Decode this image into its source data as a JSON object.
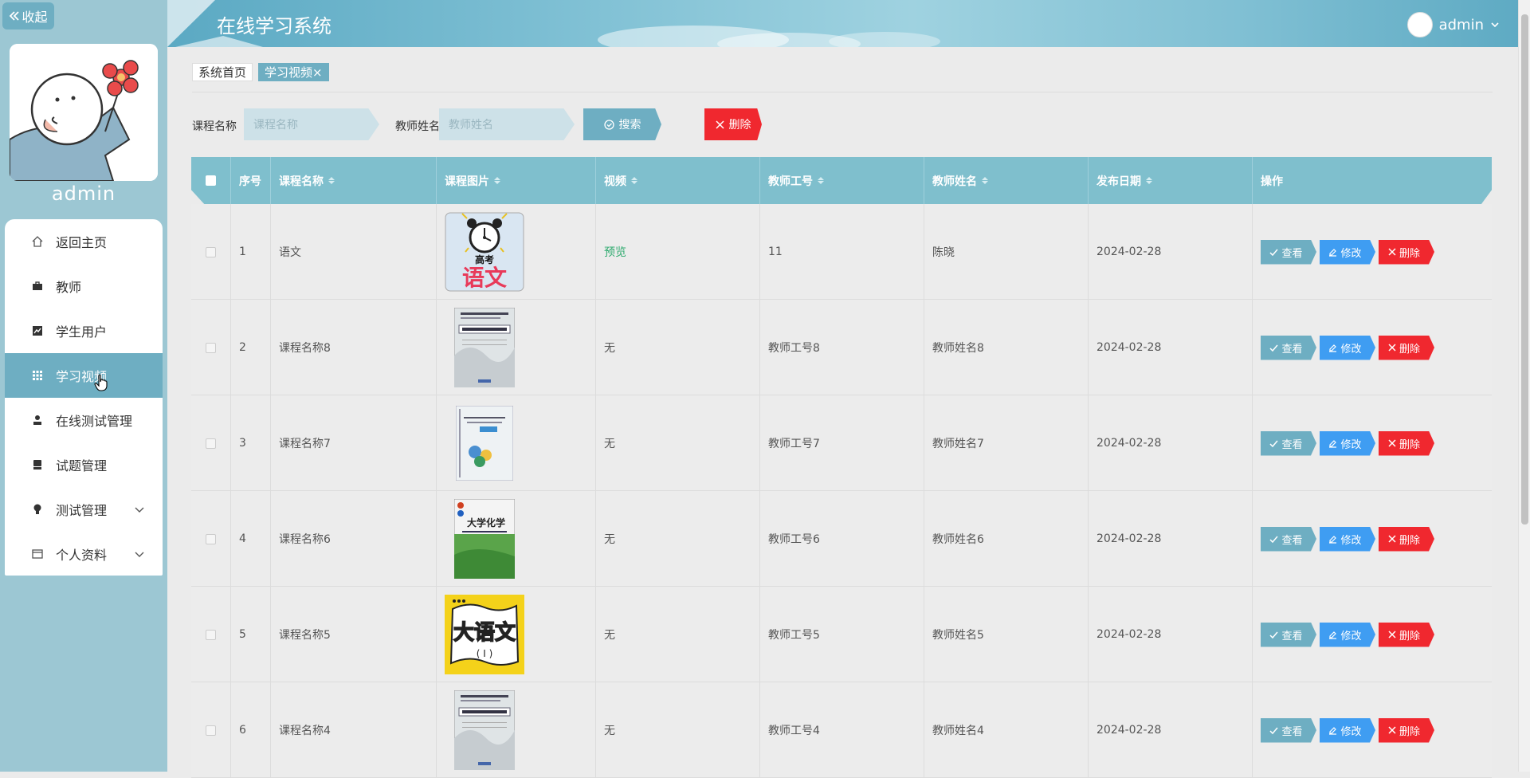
{
  "sidebar": {
    "collapse_label": "收起",
    "username": "admin",
    "items": [
      {
        "label": "返回主页",
        "icon": "home-icon"
      },
      {
        "label": "教师",
        "icon": "briefcase-icon"
      },
      {
        "label": "学生用户",
        "icon": "chart-icon"
      },
      {
        "label": "学习视频",
        "icon": "grid-icon",
        "active": true
      },
      {
        "label": "在线测试管理",
        "icon": "person-icon"
      },
      {
        "label": "试题管理",
        "icon": "monitor-icon"
      },
      {
        "label": "测试管理",
        "icon": "bulb-icon",
        "expandable": true
      },
      {
        "label": "个人资料",
        "icon": "card-icon",
        "expandable": true
      }
    ]
  },
  "header": {
    "title": "在线学习系统",
    "user_label": "admin"
  },
  "tabs": [
    {
      "label": "系统首页"
    },
    {
      "label": "学习视频×",
      "active": true
    }
  ],
  "search": {
    "course_label": "课程名称",
    "course_placeholder": "课程名称",
    "teacher_label": "教师姓名",
    "teacher_placeholder": "教师姓名",
    "search_button": "搜索",
    "delete_button": "删除"
  },
  "table": {
    "columns": [
      "序号",
      "课程名称",
      "课程图片",
      "视频",
      "教师工号",
      "教师姓名",
      "发布日期",
      "操作"
    ],
    "rows": [
      {
        "no": "1",
        "course": "语文",
        "image": "alarm-clock-chinese-cover",
        "video": "预览",
        "teacher_id": "11",
        "teacher": "陈晓",
        "date": "2024-02-28"
      },
      {
        "no": "2",
        "course": "课程名称8",
        "image": "grey-book-cover",
        "video": "无",
        "teacher_id": "教师工号8",
        "teacher": "教师姓名8",
        "date": "2024-02-28"
      },
      {
        "no": "3",
        "course": "课程名称7",
        "image": "light-book-cover",
        "video": "无",
        "teacher_id": "教师工号7",
        "teacher": "教师姓名7",
        "date": "2024-02-28"
      },
      {
        "no": "4",
        "course": "课程名称6",
        "image": "chemistry-book-cover",
        "video": "无",
        "teacher_id": "教师工号6",
        "teacher": "教师姓名6",
        "date": "2024-02-28"
      },
      {
        "no": "5",
        "course": "课程名称5",
        "image": "yellow-chinese-cover",
        "video": "无",
        "teacher_id": "教师工号5",
        "teacher": "教师姓名5",
        "date": "2024-02-28"
      },
      {
        "no": "6",
        "course": "课程名称4",
        "image": "grey-book-cover",
        "video": "无",
        "teacher_id": "教师工号4",
        "teacher": "教师姓名4",
        "date": "2024-02-28"
      }
    ],
    "actions": {
      "view": "查看",
      "edit": "修改",
      "delete": "删除"
    },
    "cover_texts": {
      "gaokao": "高考",
      "yuwen": "语文",
      "chemistry": "大学化学",
      "da_yuwen": "大语文"
    }
  },
  "colors": {
    "accent": "#6eaec2",
    "edit": "#3f9df2",
    "danger": "#f0282f",
    "preview": "#2eaa6e"
  }
}
